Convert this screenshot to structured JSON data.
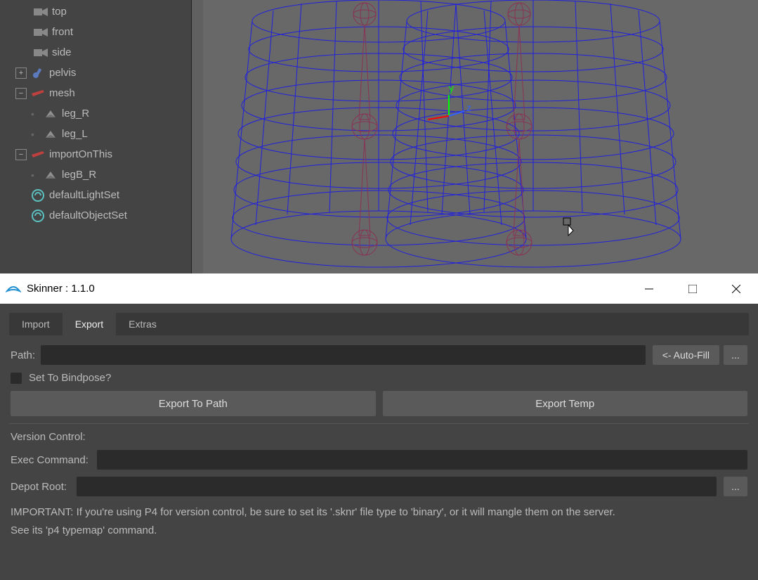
{
  "outliner": {
    "items": [
      {
        "label": "top",
        "type": "camera",
        "indent": 1
      },
      {
        "label": "front",
        "type": "camera",
        "indent": 1
      },
      {
        "label": "side",
        "type": "camera",
        "indent": 1
      },
      {
        "label": "pelvis",
        "type": "joint",
        "toggle": "plus",
        "indent": 0
      },
      {
        "label": "mesh",
        "type": "group",
        "toggle": "minus",
        "indent": 0
      },
      {
        "label": "leg_R",
        "type": "mesh",
        "indent": 1
      },
      {
        "label": "leg_L",
        "type": "mesh",
        "indent": 1
      },
      {
        "label": "importOnThis",
        "type": "group",
        "toggle": "minus",
        "indent": 0
      },
      {
        "label": "legB_R",
        "type": "mesh",
        "indent": 1
      },
      {
        "label": "defaultLightSet",
        "type": "set",
        "indent": 1
      },
      {
        "label": "defaultObjectSet",
        "type": "set",
        "indent": 1
      }
    ]
  },
  "skinner": {
    "title": "Skinner : 1.1.0",
    "tabs": {
      "import": "Import",
      "export": "Export",
      "extras": "Extras"
    },
    "path_label": "Path:",
    "path_value": "",
    "autofill": "<- Auto-Fill",
    "browse": "...",
    "bindpose_label": "Set To Bindpose?",
    "export_path": "Export To Path",
    "export_temp": "Export Temp",
    "vc_label": "Version Control:",
    "exec_label": "Exec Command:",
    "exec_value": "",
    "depot_label": "Depot Root:",
    "depot_value": "",
    "important1": "IMPORTANT: If you're using P4 for version control, be sure to set its '.sknr' file type to 'binary', or it will mangle them on the server.",
    "important2": "See its 'p4 typemap' command."
  }
}
